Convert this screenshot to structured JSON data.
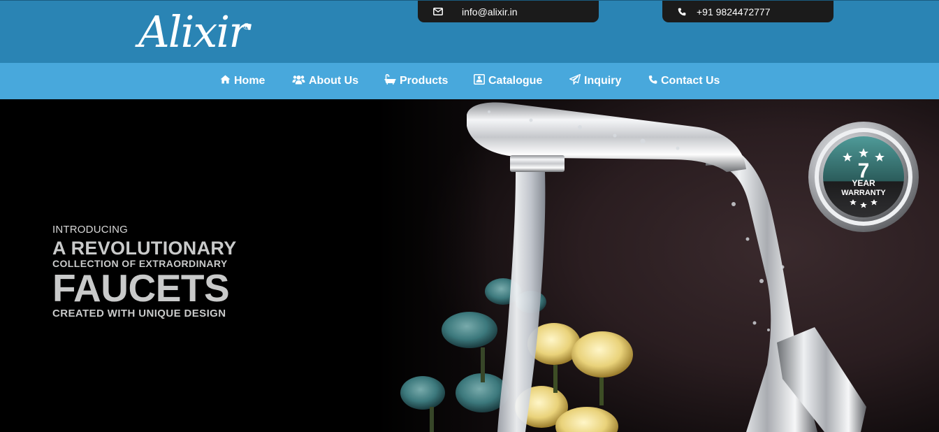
{
  "brand": {
    "name": "Alixir",
    "registered_mark": "®"
  },
  "contact": {
    "email": {
      "icon": "envelope-icon",
      "text": "info@alixir.in"
    },
    "phone": {
      "icon": "phone-icon",
      "text": "+91 9824472777"
    }
  },
  "nav": {
    "items": [
      {
        "label": "Home",
        "icon": "home-icon"
      },
      {
        "label": "About Us",
        "icon": "users-icon"
      },
      {
        "label": "Products",
        "icon": "bathtub-icon"
      },
      {
        "label": "Catalogue",
        "icon": "catalogue-icon"
      },
      {
        "label": "Inquiry",
        "icon": "paper-plane-icon"
      },
      {
        "label": "Contact Us",
        "icon": "phone-icon"
      }
    ]
  },
  "hero": {
    "line1": "INTRODUCING",
    "line2": "A REVOLUTIONARY",
    "line3": "COLLECTION OF EXTRAORDINARY",
    "line4": "FAUCETS",
    "line5": "CREATED WITH UNIQUE DESIGN",
    "badge": {
      "number": "7",
      "line1": "YEAR",
      "line2": "WARRANTY"
    }
  },
  "colors": {
    "topbar": "#2a84b4",
    "navbar": "#48a8dc",
    "pill": "#1b1b1b",
    "hero_bg": "#000000"
  }
}
